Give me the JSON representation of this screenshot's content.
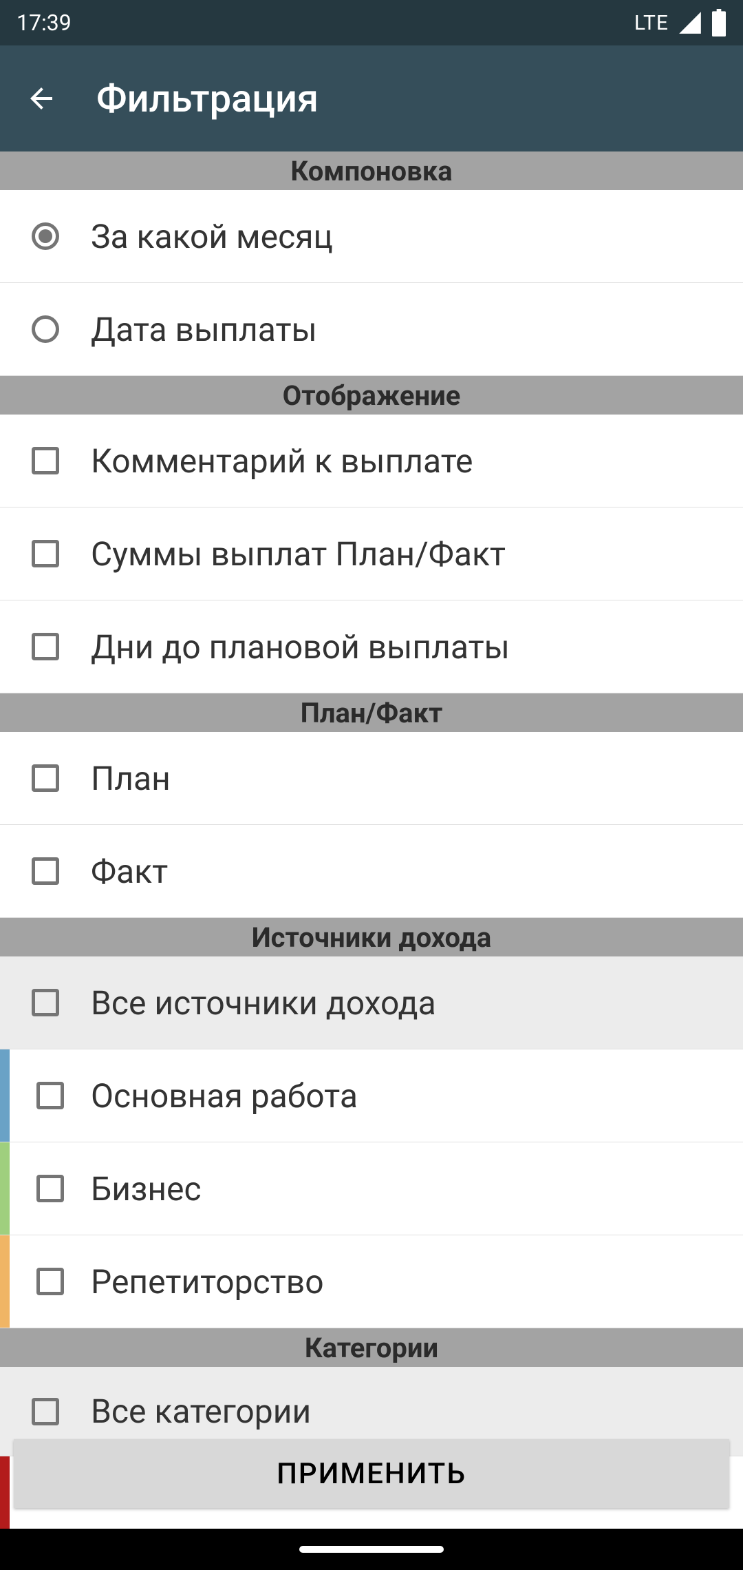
{
  "statusBar": {
    "time": "17:39",
    "network": "LTE"
  },
  "appBar": {
    "title": "Фильтрация"
  },
  "sections": {
    "layout": {
      "title": "Компоновка"
    },
    "display": {
      "title": "Отображение"
    },
    "planfact": {
      "title": "План/Факт"
    },
    "income": {
      "title": "Источники дохода"
    },
    "categories": {
      "title": "Категории"
    }
  },
  "items": {
    "by_month": "За какой месяц",
    "pay_date": "Дата выплаты",
    "comment": "Комментарий к выплате",
    "sums": "Суммы выплат План/Факт",
    "days_until": "Дни до плановой выплаты",
    "plan": "План",
    "fact": "Факт",
    "all_income": "Все источники дохода",
    "main_job": "Основная работа",
    "business": "Бизнес",
    "tutoring": "Репетиторство",
    "all_categories": "Все категории"
  },
  "applyButton": "ПРИМЕНИТЬ"
}
